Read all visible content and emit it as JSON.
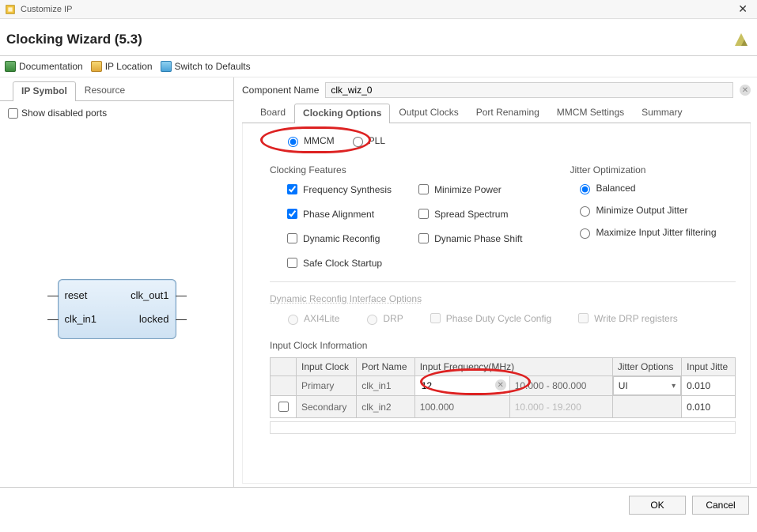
{
  "window": {
    "title": "Customize IP"
  },
  "page_title": "Clocking Wizard (5.3)",
  "toolbar": {
    "documentation": "Documentation",
    "ip_location": "IP Location",
    "switch_defaults": "Switch to Defaults"
  },
  "left": {
    "tabs": {
      "ip_symbol": "IP Symbol",
      "resource": "Resource"
    },
    "show_disabled_ports": "Show disabled ports",
    "block": {
      "port_reset": "reset",
      "port_clk_in1": "clk_in1",
      "port_clk_out1": "clk_out1",
      "port_locked": "locked"
    }
  },
  "component": {
    "label": "Component Name",
    "value": "clk_wiz_0"
  },
  "tabs": {
    "board": "Board",
    "clocking_options": "Clocking Options",
    "output_clocks": "Output Clocks",
    "port_renaming": "Port Renaming",
    "mmcm_settings": "MMCM Settings",
    "summary": "Summary"
  },
  "primitive": {
    "mmcm": "MMCM",
    "pll": "PLL"
  },
  "clocking_features": {
    "title": "Clocking Features",
    "freq_synth": "Frequency Synthesis",
    "phase_align": "Phase Alignment",
    "dyn_reconfig": "Dynamic Reconfig",
    "safe_startup": "Safe Clock Startup",
    "min_power": "Minimize Power",
    "spread": "Spread Spectrum",
    "dyn_phase": "Dynamic Phase Shift"
  },
  "jitter": {
    "title": "Jitter Optimization",
    "balanced": "Balanced",
    "min_out": "Minimize Output Jitter",
    "max_in": "Maximize Input Jitter filtering"
  },
  "dyn": {
    "title": "Dynamic Reconfig Interface Options",
    "axi4lite": "AXI4Lite",
    "drp": "DRP",
    "phase_duty": "Phase Duty Cycle Config",
    "write_drp": "Write DRP registers"
  },
  "input_clock": {
    "title": "Input Clock Information",
    "headers": {
      "blank": "",
      "input_clock": "Input Clock",
      "port_name": "Port Name",
      "input_freq": "Input Frequency(MHz)",
      "range": "",
      "jitter_opts": "Jitter Options",
      "input_jitter": "Input Jitte"
    },
    "rows": [
      {
        "enabled_lock": true,
        "name": "Primary",
        "port": "clk_in1",
        "freq": "12",
        "range": "10.000 - 800.000",
        "jopt": "UI",
        "jval": "0.010"
      },
      {
        "enabled_lock": false,
        "name": "Secondary",
        "port": "clk_in2",
        "freq": "100.000",
        "range": "10.000 - 19.200",
        "jopt": "",
        "jval": "0.010"
      }
    ]
  },
  "buttons": {
    "ok": "OK",
    "cancel": "Cancel"
  }
}
